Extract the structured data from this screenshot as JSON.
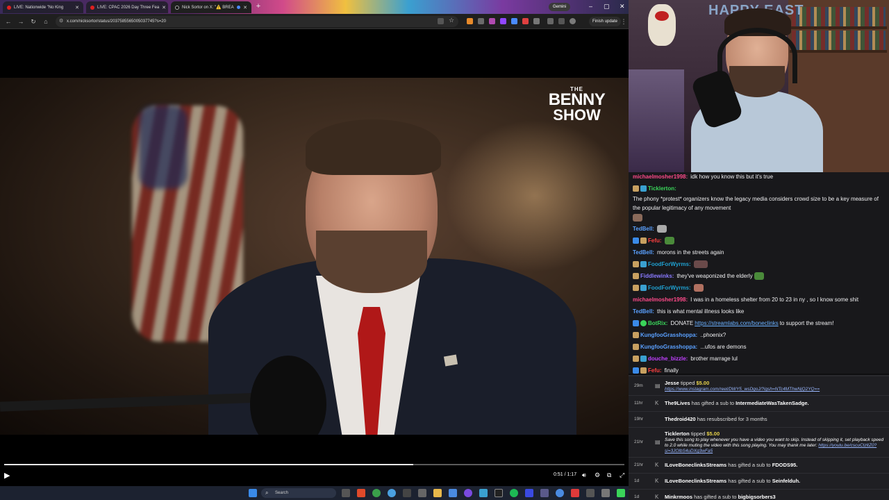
{
  "browser": {
    "tabs": [
      {
        "label": "LIVE: Nationwide \"No King"
      },
      {
        "label": "LIVE: CPAC 2026 Day Three Fea"
      },
      {
        "label": "Nick Sortor on X: \"⚠️ BREA"
      }
    ],
    "gemini_label": "Gemini",
    "url": "x.com/nicksortor/status/2037585565005037745?s=20",
    "finish_update": "Finish update"
  },
  "video": {
    "logo_the": "THE",
    "logo_benny": "BENNY",
    "logo_show": "SHOW",
    "time": "0:51 / 1:17",
    "progress": 0.66
  },
  "taskbar": {
    "search_placeholder": "Search"
  },
  "webcam": {
    "sign_text": "HAPPY EAST"
  },
  "chat": {
    "messages": [
      {
        "user": "michaelmosher1998:",
        "color": "#ff4a8a",
        "text": "idk how you know this but it's true"
      },
      {
        "user": "Ticklerton:",
        "color": "#3ad45a",
        "text": "The phony *protest* organizers know the legacy media considers crowd size to be a key measure of the popular legitimacy of any movement"
      },
      {
        "user": "TedBell:",
        "color": "#5aa0ff",
        "text": ""
      },
      {
        "user": "Fefu:",
        "color": "#ff4040",
        "text": ""
      },
      {
        "user": "TedBell:",
        "color": "#5aa0ff",
        "text": "morons in the streets again"
      },
      {
        "user": "FoodForWyrms:",
        "color": "#1fa0d0",
        "text": ""
      },
      {
        "user": "Fiddlewinks:",
        "color": "#8a7aff",
        "text": "they've weaponized the elderly"
      },
      {
        "user": "FoodForWyrms:",
        "color": "#1fa0d0",
        "text": ""
      },
      {
        "user": "michaelmosher1998:",
        "color": "#ff4a8a",
        "text": "I was in a homeless shelter from 20 to 23 in ny , so I know some shit"
      },
      {
        "user": "TedBell:",
        "color": "#5aa0ff",
        "text": "this is what mental illness looks like"
      },
      {
        "user": "BotRix:",
        "color": "#3ad45a",
        "text": "DONATE",
        "link": "https://streamlabs.com/boneclinks",
        "after": "to support the stream!"
      },
      {
        "user": "KungfooGrasshoppa:",
        "color": "#5aa0ff",
        "text": "..phoenix?"
      },
      {
        "user": "KungfooGrasshoppa:",
        "color": "#5aa0ff",
        "text": "...ufos are demons"
      },
      {
        "user": "douche_bizzle:",
        "color": "#c040ff",
        "text": "brother marrage lul"
      },
      {
        "user": "Fefu:",
        "color": "#ff4040",
        "text": "finally"
      }
    ]
  },
  "alerts": [
    {
      "ago": "29m",
      "who": "Jesse",
      "action": "tipped",
      "amount": "$5.00",
      "note_link": "https://www.instagram.com/reel/DWY5_wsDgoJ/?igsh=NTc4MThwNjQ2YQ=="
    },
    {
      "ago": "11hr",
      "who": "The9Lives",
      "action": "has gifted a sub to",
      "target": "IntermediateWasTakenSadge."
    },
    {
      "ago": "19hr",
      "who": "Thedroid420",
      "action": "has resubscribed for 3 months"
    },
    {
      "ago": "21hr",
      "who": "Ticklerton",
      "action": "tipped",
      "amount": "$5.00",
      "note": "Save this song to play whenever you have a video you want to skip. Instead of skipping it, set playback speed to 2.0 while muting the video with this song playing. You may thank me later:",
      "note_link": "https://youtu.be/cscuCtzltZ0?si=3JOlbS4uDXg3wFa5"
    },
    {
      "ago": "21hr",
      "who": "ILoveBoneclinksStreams",
      "action": "has gifted a sub to",
      "target": "FDODS95."
    },
    {
      "ago": "1d",
      "who": "ILoveBoneclinksStreams",
      "action": "has gifted a sub to",
      "target": "Seinfelduh."
    },
    {
      "ago": "1d",
      "who": "Minkrmoos",
      "action": "has gifted a sub to",
      "target": "bigbigsorbers3"
    }
  ]
}
